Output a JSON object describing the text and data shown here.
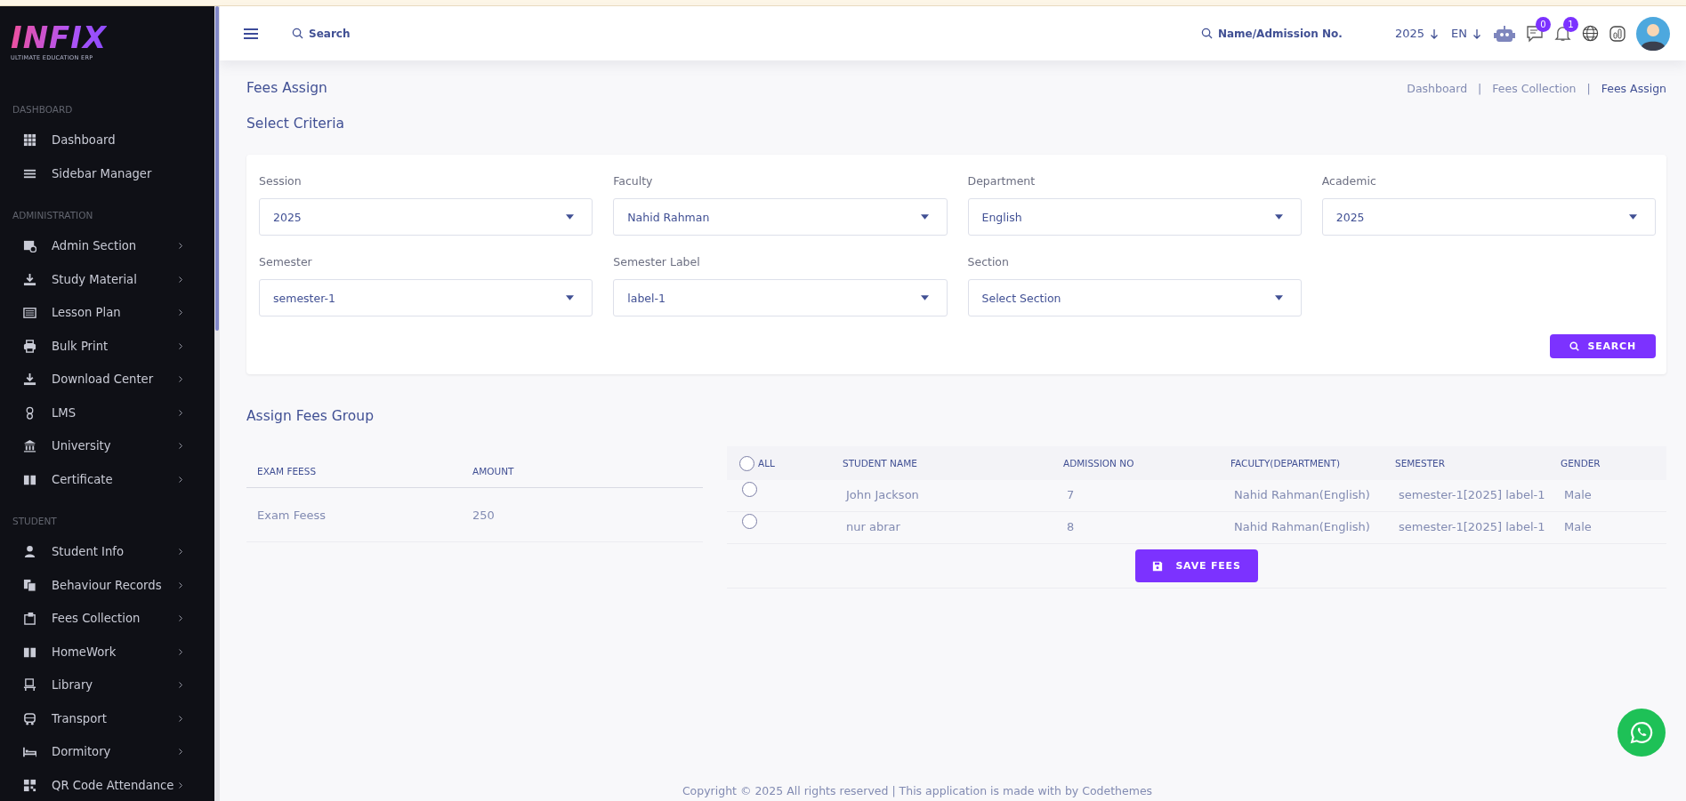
{
  "sidebar": {
    "logo": {
      "text": "INFIX",
      "tagline": "ULTIMATE EDUCATION ERP"
    },
    "sections": [
      {
        "title": "DASHBOARD",
        "items": [
          {
            "label": "Dashboard",
            "has_submenu": false
          },
          {
            "label": "Sidebar Manager",
            "has_submenu": false
          }
        ]
      },
      {
        "title": "ADMINISTRATION",
        "items": [
          {
            "label": "Admin Section",
            "has_submenu": true
          },
          {
            "label": "Study Material",
            "has_submenu": true
          },
          {
            "label": "Lesson Plan",
            "has_submenu": true
          },
          {
            "label": "Bulk Print",
            "has_submenu": true
          },
          {
            "label": "Download Center",
            "has_submenu": true
          },
          {
            "label": "LMS",
            "has_submenu": true
          },
          {
            "label": "University",
            "has_submenu": true
          },
          {
            "label": "Certificate",
            "has_submenu": true
          }
        ]
      },
      {
        "title": "STUDENT",
        "items": [
          {
            "label": "Student Info",
            "has_submenu": true
          },
          {
            "label": "Behaviour Records",
            "has_submenu": true
          },
          {
            "label": "Fees Collection",
            "has_submenu": true
          },
          {
            "label": "HomeWork",
            "has_submenu": true
          },
          {
            "label": "Library",
            "has_submenu": true
          },
          {
            "label": "Transport",
            "has_submenu": true
          },
          {
            "label": "Dormitory",
            "has_submenu": true
          },
          {
            "label": "QR Code Attendance",
            "has_submenu": true
          }
        ]
      }
    ]
  },
  "topbar": {
    "search": {
      "placeholder": "Search"
    },
    "student_search": {
      "placeholder": "Name/Admission No."
    },
    "year": "2025",
    "language": "EN",
    "messages_badge": "0",
    "notifications_badge": "1"
  },
  "page": {
    "title": "Fees Assign",
    "breadcrumb_separator": "|",
    "breadcrumbs": [
      {
        "label": "Dashboard",
        "current": false
      },
      {
        "label": "Fees Collection",
        "current": false
      },
      {
        "label": "Fees Assign",
        "current": true
      }
    ]
  },
  "criteria": {
    "title": "Select Criteria",
    "fields": [
      {
        "label": "Session",
        "value": "2025"
      },
      {
        "label": "Faculty",
        "value": "Nahid Rahman"
      },
      {
        "label": "Department",
        "value": "English"
      },
      {
        "label": "Academic",
        "value": "2025"
      },
      {
        "label": "Semester",
        "value": "semester-1"
      },
      {
        "label": "Semester Label",
        "value": "label-1"
      },
      {
        "label": "Section",
        "placeholder": "Select Section"
      }
    ],
    "search_button": "SEARCH"
  },
  "fees_group": {
    "title": "Assign Fees Group",
    "columns": [
      "EXAM FEESS",
      "AMOUNT"
    ],
    "rows": [
      [
        "Exam Feess",
        "250"
      ]
    ]
  },
  "students": {
    "select_all": {
      "label": "ALL",
      "checked": false
    },
    "columns": [
      "STUDENT NAME",
      "ADMISSION NO",
      "FACULTY(DEPARTMENT)",
      "SEMESTER",
      "GENDER"
    ],
    "rows": [
      {
        "checked": false,
        "cells": [
          "John Jackson",
          "7",
          "Nahid Rahman(English)",
          "semester-1[2025] label-1",
          "Male"
        ]
      },
      {
        "checked": false,
        "cells": [
          "nur abrar",
          "8",
          "Nahid Rahman(English)",
          "semester-1[2025] label-1",
          "Male"
        ]
      }
    ],
    "save_button": "SAVE FEES"
  },
  "footer": {
    "text": "Copyright © 2025 All rights reserved | This application is made with by Codethemes"
  }
}
